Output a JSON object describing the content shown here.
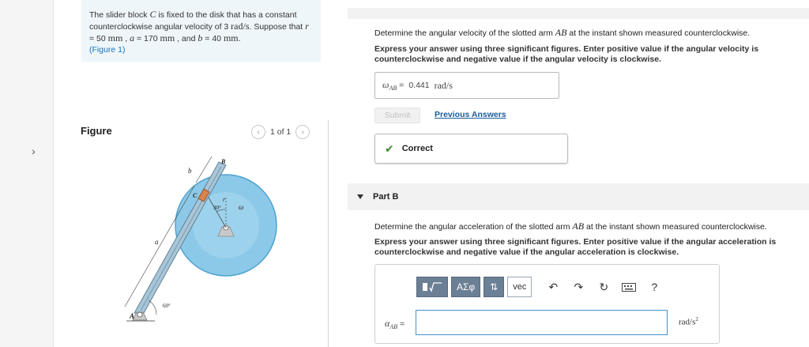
{
  "problem": {
    "text_1": "The slider block ",
    "var_C": "C",
    "text_2": " is fixed to the disk that has a constant counterclockwise angular velocity of 3 ",
    "unit_rad_s": "rad/s",
    "text_3": ". Suppose that ",
    "var_r": "r",
    "text_4": " = 50 ",
    "unit_mm_1": "mm",
    "text_5": " , ",
    "var_a": "a",
    "text_6": " = 170 ",
    "unit_mm_2": "mm",
    "text_7": " , and ",
    "var_b": "b",
    "text_8": " = 40 ",
    "unit_mm_3": "mm",
    "text_9": ".",
    "figure_link": "(Figure 1)"
  },
  "figure": {
    "heading": "Figure",
    "pager_text": "1 of 1",
    "prev_icon": "chevron-left-icon",
    "next_icon": "chevron-right-icon",
    "labels": {
      "A": "A",
      "B": "B",
      "C": "C",
      "a": "a",
      "b": "b",
      "r": "r",
      "omega": "ω",
      "angle_30": "30°",
      "angle_60": "60°"
    },
    "colors": {
      "disk": "#8cc9e8",
      "disk_dark": "#4fa3d1",
      "arm": "#a9c6d8",
      "slider": "#d9844c",
      "base": "#c9c9c9"
    }
  },
  "part_a": {
    "prompt_1": "Determine the angular velocity of the slotted arm ",
    "prompt_var": "AB",
    "prompt_2": " at the instant shown measured counterclockwise.",
    "instructions": "Express your answer using three significant figures. Enter positive value if the angular velocity is counterclockwise and negative value if the angular velocity is clockwise.",
    "answer_label": "ω",
    "answer_sub": "AB",
    "answer_eq": " = ",
    "answer_value": "0.441",
    "answer_unit": "rad/s",
    "submit_label": "Submit",
    "previous_answers_label": "Previous Answers",
    "feedback": "Correct",
    "feedback_color": "#3c8a2e"
  },
  "part_b": {
    "title": "Part B",
    "prompt_1": "Determine the angular acceleration of the slotted arm ",
    "prompt_var": "AB",
    "prompt_2": " at the instant shown measured counterclockwise.",
    "instructions": "Express your answer using three significant figures. Enter positive value if the angular acceleration is counterclockwise and negative value if the angular acceleration is clockwise.",
    "toolbar": {
      "templates_icon": "fraction-root-template-icon",
      "greek_label": "ΑΣφ",
      "arrows_label": "⇅",
      "vec_label": "vec",
      "undo_icon": "undo-icon",
      "redo_icon": "redo-icon",
      "reset_icon": "reset-icon",
      "keyboard_icon": "keyboard-icon",
      "help_label": "?"
    },
    "answer_label": "α",
    "answer_sub": "AB",
    "answer_eq": " =",
    "answer_value": "",
    "answer_unit": "rad/s",
    "answer_unit_exp": "2"
  }
}
